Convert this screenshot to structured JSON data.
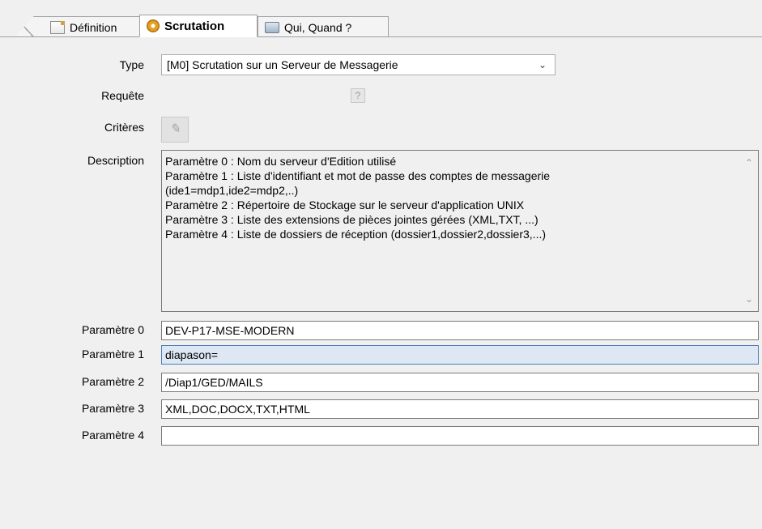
{
  "tabs": {
    "definition": "Définition",
    "scrutation": "Scrutation",
    "qui_quand": "Qui, Quand ?"
  },
  "labels": {
    "type": "Type",
    "requete": "Requête",
    "criteres": "Critères",
    "description": "Description",
    "param0": "Paramètre 0",
    "param1": "Paramètre 1",
    "param2": "Paramètre 2",
    "param3": "Paramètre 3",
    "param4": "Paramètre 4"
  },
  "type_value": "[M0] Scrutation sur un Serveur de Messagerie",
  "requete_button": "?",
  "description_lines": [
    "Paramètre 0 : Nom du serveur d'Edition utilisé",
    "Paramètre 1 : Liste d'identifiant et mot de passe des comptes de messagerie",
    "(ide1=mdp1,ide2=mdp2,..)",
    "Paramètre 2 : Répertoire de Stockage sur le serveur d'application UNIX",
    "Paramètre 3 : Liste des extensions de pièces jointes gérées (XML,TXT, ...)",
    "Paramètre 4 : Liste de dossiers de réception (dossier1,dossier2,dossier3,...)"
  ],
  "params": {
    "p0": "DEV-P17-MSE-MODERN",
    "p1": "diapason=",
    "p2": "/Diap1/GED/MAILS",
    "p3": "XML,DOC,DOCX,TXT,HTML",
    "p4": ""
  },
  "icons": {
    "definition": "document-icon",
    "scrutation": "gear-icon",
    "qui_quand": "screen-icon",
    "criteres": "criteria-icon"
  }
}
